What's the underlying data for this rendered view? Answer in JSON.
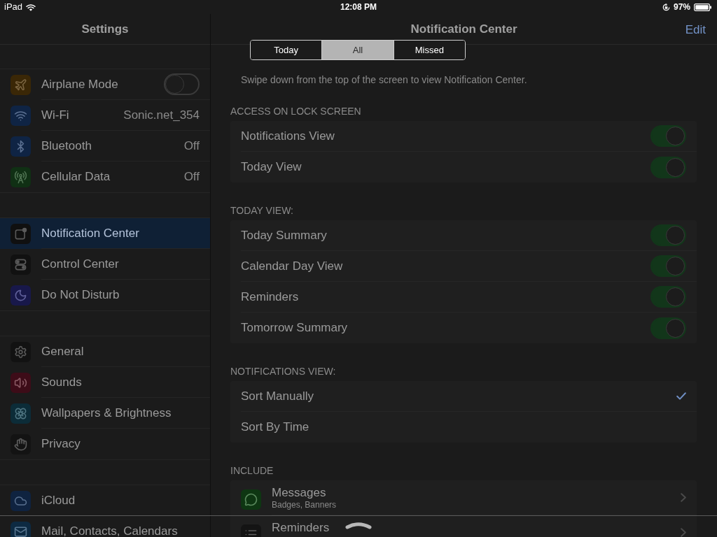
{
  "status_bar": {
    "device": "iPad",
    "time": "12:08 PM",
    "battery": "97%"
  },
  "notification_center": {
    "tabs": [
      {
        "label": "Today",
        "selected": false
      },
      {
        "label": "All",
        "selected": true
      },
      {
        "label": "Missed",
        "selected": false
      }
    ]
  },
  "sidebar": {
    "title": "Settings",
    "groups": [
      {
        "items": [
          {
            "label": "Airplane Mode",
            "kind": "toggle",
            "on": false,
            "selected": false
          },
          {
            "label": "Wi-Fi",
            "kind": "value",
            "value": "Sonic.net_354",
            "selected": false
          },
          {
            "label": "Bluetooth",
            "kind": "value",
            "value": "Off",
            "selected": false
          },
          {
            "label": "Cellular Data",
            "kind": "value",
            "value": "Off",
            "selected": false
          }
        ]
      },
      {
        "items": [
          {
            "label": "Notification Center",
            "kind": "link",
            "selected": true
          },
          {
            "label": "Control Center",
            "kind": "link",
            "selected": false
          },
          {
            "label": "Do Not Disturb",
            "kind": "link",
            "selected": false
          }
        ]
      },
      {
        "items": [
          {
            "label": "General",
            "kind": "link",
            "selected": false
          },
          {
            "label": "Sounds",
            "kind": "link",
            "selected": false
          },
          {
            "label": "Wallpapers & Brightness",
            "kind": "link",
            "selected": false
          },
          {
            "label": "Privacy",
            "kind": "link",
            "selected": false
          }
        ]
      },
      {
        "items": [
          {
            "label": "iCloud",
            "kind": "link",
            "selected": false
          },
          {
            "label": "Mail, Contacts, Calendars",
            "kind": "link",
            "selected": false
          }
        ]
      }
    ]
  },
  "detail": {
    "title": "Notification Center",
    "action": "Edit",
    "description": "Swipe down from the top of the screen to view Notification Center.",
    "sections": [
      {
        "header": "ACCESS ON LOCK SCREEN",
        "rows": [
          {
            "kind": "toggle",
            "label": "Notifications View",
            "on": true
          },
          {
            "kind": "toggle",
            "label": "Today View",
            "on": true
          }
        ]
      },
      {
        "header": "TODAY VIEW:",
        "rows": [
          {
            "kind": "toggle",
            "label": "Today Summary",
            "on": true
          },
          {
            "kind": "toggle",
            "label": "Calendar Day View",
            "on": true
          },
          {
            "kind": "toggle",
            "label": "Reminders",
            "on": true
          },
          {
            "kind": "toggle",
            "label": "Tomorrow Summary",
            "on": true
          }
        ]
      },
      {
        "header": "NOTIFICATIONS VIEW:",
        "rows": [
          {
            "kind": "option",
            "label": "Sort Manually",
            "selected": true
          },
          {
            "kind": "option",
            "label": "Sort By Time",
            "selected": false
          }
        ]
      },
      {
        "header": "INCLUDE",
        "rows": [
          {
            "kind": "app",
            "label": "Messages",
            "detail": "Badges, Banners"
          },
          {
            "kind": "app",
            "label": "Reminders"
          }
        ]
      }
    ]
  }
}
